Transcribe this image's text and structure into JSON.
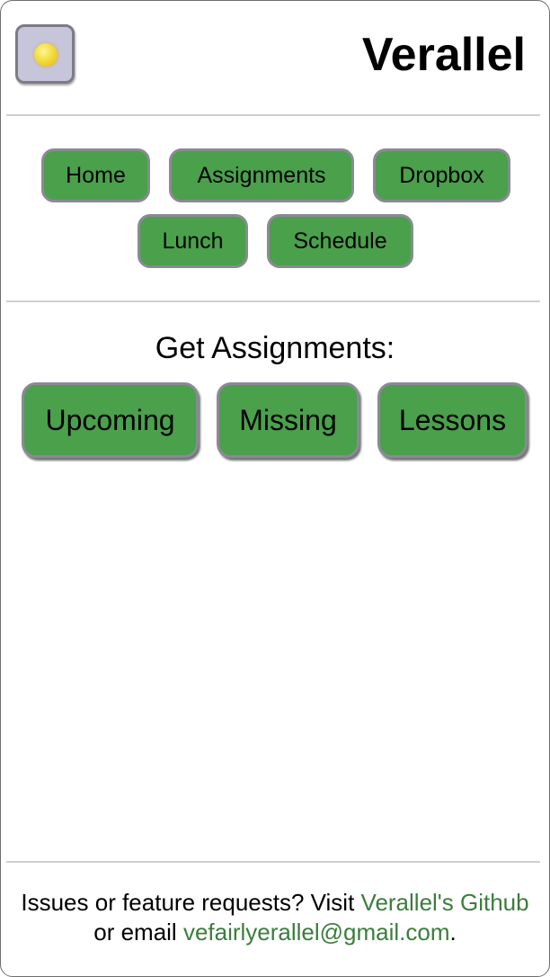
{
  "header": {
    "title": "Verallel",
    "theme_toggle_icon": "sun-icon"
  },
  "nav": {
    "items": [
      {
        "label": "Home"
      },
      {
        "label": "Assignments"
      },
      {
        "label": "Dropbox"
      },
      {
        "label": "Lunch"
      },
      {
        "label": "Schedule"
      }
    ]
  },
  "assignments": {
    "heading": "Get Assignments:",
    "buttons": [
      {
        "label": "Upcoming"
      },
      {
        "label": "Missing"
      },
      {
        "label": "Lessons"
      }
    ]
  },
  "footer": {
    "text_before": "Issues or feature requests? Visit ",
    "github_link": "Verallel's Github",
    "text_middle": " or email ",
    "email_link": "vefairlyerallel@gmail.com",
    "text_after": "."
  },
  "colors": {
    "button_green": "#4aa04b",
    "link_green": "#3b7d3c",
    "toggle_bg": "#c7c5d9"
  }
}
